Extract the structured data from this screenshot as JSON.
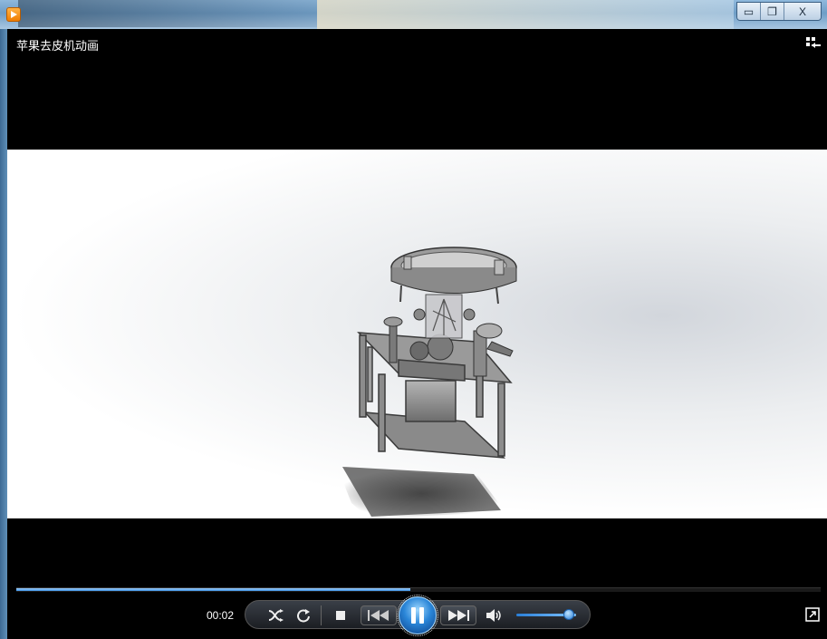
{
  "window": {
    "title": "苹果去皮机动画",
    "controls": {
      "minimize": "▭",
      "restore": "❐",
      "close": "X"
    }
  },
  "player": {
    "elapsed_time": "00:02",
    "progress_fraction": 0.49,
    "volume_fraction": 0.88,
    "state": "playing"
  },
  "icons": {
    "app": "player-app-icon",
    "layout": "layout-toggle-icon",
    "shuffle": "shuffle-icon",
    "repeat": "repeat-icon",
    "stop": "stop-icon",
    "previous": "previous-icon",
    "pause": "pause-icon",
    "next": "next-icon",
    "volume": "speaker-icon",
    "fullscreen": "fullscreen-icon"
  },
  "colors": {
    "accent": "#2a86d8",
    "video_bg": "#000000"
  }
}
